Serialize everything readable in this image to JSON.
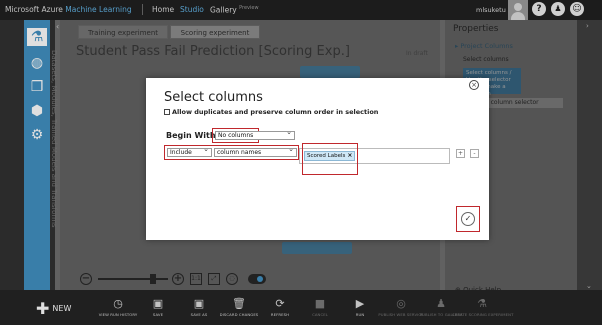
{
  "topbar": {
    "brand_main": "Microsoft Azure",
    "brand_sub": "Machine Learning",
    "nav": [
      {
        "label": "Home"
      },
      {
        "label": "Studio"
      },
      {
        "label": "Gallery",
        "tag": "Preview"
      }
    ],
    "username": "mlsuketu",
    "icons": [
      "help-icon",
      "people-icon",
      "smiley-icon"
    ]
  },
  "sidebar": {
    "icons": [
      "flask-icon",
      "globe-icon",
      "cubes-icon",
      "cube-icon",
      "gear-icon"
    ],
    "vertical_text": "Datasets, Modules, Trained Models and Transforms"
  },
  "canvas": {
    "tabs": [
      {
        "label": "Training experiment"
      },
      {
        "label": "Scoring experiment"
      }
    ],
    "experiment_title": "Student Pass Fail Prediction [Scoring Exp.]",
    "status": "In draft"
  },
  "properties": {
    "title": "Properties",
    "section": "Project Columns",
    "field_label": "Select columns",
    "info_text": "Select columns / Use the selector tool to make a selection",
    "launch_button": "Launch column selector",
    "quick_help": "Quick Help"
  },
  "dialog": {
    "title": "Select columns",
    "checkbox_label": "Allow duplicates and preserve column order in selection",
    "checkbox_checked": false,
    "begin_with_label": "Begin With",
    "begin_with_value": "No columns",
    "rule_mode": "Include",
    "rule_type": "column names",
    "selected_tag": "Scored Labels",
    "add_label": "+",
    "remove_label": "-",
    "close_glyph": "×",
    "ok_glyph": "✓"
  },
  "commands": {
    "new_label": "NEW",
    "items": [
      {
        "label": "VIEW RUN HISTORY",
        "icon": "clock-icon",
        "enabled": true
      },
      {
        "label": "SAVE",
        "icon": "save-icon",
        "enabled": true
      },
      {
        "label": "SAVE AS",
        "icon": "save-as-icon",
        "enabled": true
      },
      {
        "label": "DISCARD CHANGES",
        "icon": "trash-icon",
        "enabled": true
      },
      {
        "label": "REFRESH",
        "icon": "refresh-icon",
        "enabled": true
      },
      {
        "label": "CANCEL",
        "icon": "stop-icon",
        "enabled": false
      },
      {
        "label": "RUN",
        "icon": "play-icon",
        "enabled": true
      },
      {
        "label": "PUBLISH WEB SERVICE",
        "icon": "web-service-icon",
        "enabled": false
      },
      {
        "label": "PUBLISH TO GALLERY",
        "icon": "gallery-icon",
        "enabled": false
      },
      {
        "label": "CREATE SCORING EXPERIMENT",
        "icon": "scoring-icon",
        "enabled": false
      }
    ]
  },
  "colors": {
    "accent": "#3c8dc0",
    "topbar_bg": "#1a1a1a",
    "highlight_border": "#c0282d",
    "tag_bg": "#cfe7f6"
  }
}
